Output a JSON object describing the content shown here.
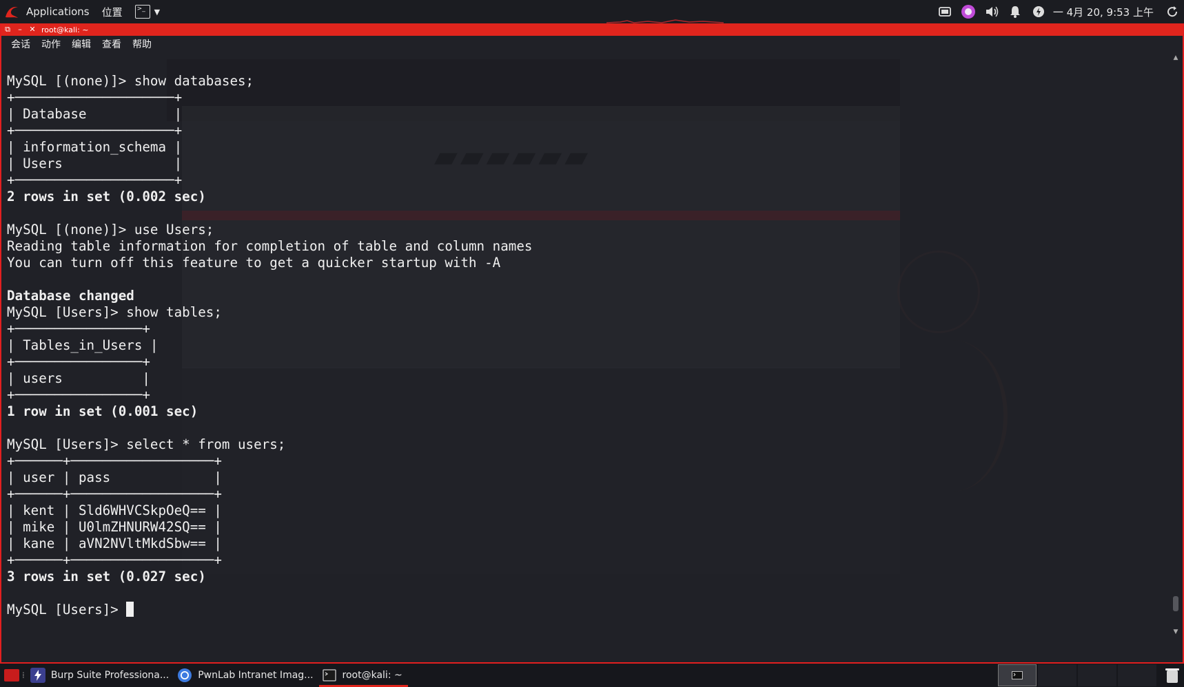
{
  "top_panel": {
    "applications_label": "Applications",
    "places_label": "位置",
    "clock": "一 4月 20,  9:53 上午"
  },
  "window": {
    "title": "root@kali: ~",
    "menu": [
      "会话",
      "动作",
      "编辑",
      "查看",
      "帮助"
    ]
  },
  "terminal": {
    "lines": [
      {
        "text": "MySQL [(none)]> show databases;",
        "bold": false
      },
      {
        "text": "+────────────────────+",
        "bold": false
      },
      {
        "text": "| Database           |",
        "bold": false
      },
      {
        "text": "+────────────────────+",
        "bold": false
      },
      {
        "text": "| information_schema |",
        "bold": false
      },
      {
        "text": "| Users              |",
        "bold": false
      },
      {
        "text": "+────────────────────+",
        "bold": false
      },
      {
        "text": "2 rows in set (0.002 sec)",
        "bold": true
      },
      {
        "text": "",
        "bold": false
      },
      {
        "text": "MySQL [(none)]> use Users;",
        "bold": false
      },
      {
        "text": "Reading table information for completion of table and column names",
        "bold": false
      },
      {
        "text": "You can turn off this feature to get a quicker startup with -A",
        "bold": false
      },
      {
        "text": "",
        "bold": false
      },
      {
        "text": "Database changed",
        "bold": true
      },
      {
        "text": "MySQL [Users]> show tables;",
        "bold": false
      },
      {
        "text": "+────────────────+",
        "bold": false
      },
      {
        "text": "| Tables_in_Users |",
        "bold": false
      },
      {
        "text": "+────────────────+",
        "bold": false
      },
      {
        "text": "| users          |",
        "bold": false
      },
      {
        "text": "+────────────────+",
        "bold": false
      },
      {
        "text": "1 row in set (0.001 sec)",
        "bold": true
      },
      {
        "text": "",
        "bold": false
      },
      {
        "text": "MySQL [Users]> select * from users;",
        "bold": false
      },
      {
        "text": "+──────+──────────────────+",
        "bold": false
      },
      {
        "text": "| user | pass             |",
        "bold": false
      },
      {
        "text": "+──────+──────────────────+",
        "bold": false
      },
      {
        "text": "| kent | Sld6WHVCSkpOeQ== |",
        "bold": false
      },
      {
        "text": "| mike | U0lmZHNURW42SQ== |",
        "bold": false
      },
      {
        "text": "| kane | aVN2NVltMkdSbw== |",
        "bold": false
      },
      {
        "text": "+──────+──────────────────+",
        "bold": false
      },
      {
        "text": "3 rows in set (0.027 sec)",
        "bold": true
      },
      {
        "text": "",
        "bold": false
      },
      {
        "text": "MySQL [Users]> ",
        "bold": false
      }
    ]
  },
  "taskbar": {
    "tasks": [
      {
        "label": "Burp Suite Professiona...",
        "icon": "burp-icon",
        "active": false
      },
      {
        "label": "PwnLab Intranet Imag...",
        "icon": "chromium-icon",
        "active": false
      },
      {
        "label": "root@kali: ~",
        "icon": "terminal-icon",
        "active": true
      }
    ]
  },
  "colors": {
    "accent_red": "#e0251d",
    "terminal_bg": "#202127",
    "terminal_fg": "#f0f0f0"
  }
}
